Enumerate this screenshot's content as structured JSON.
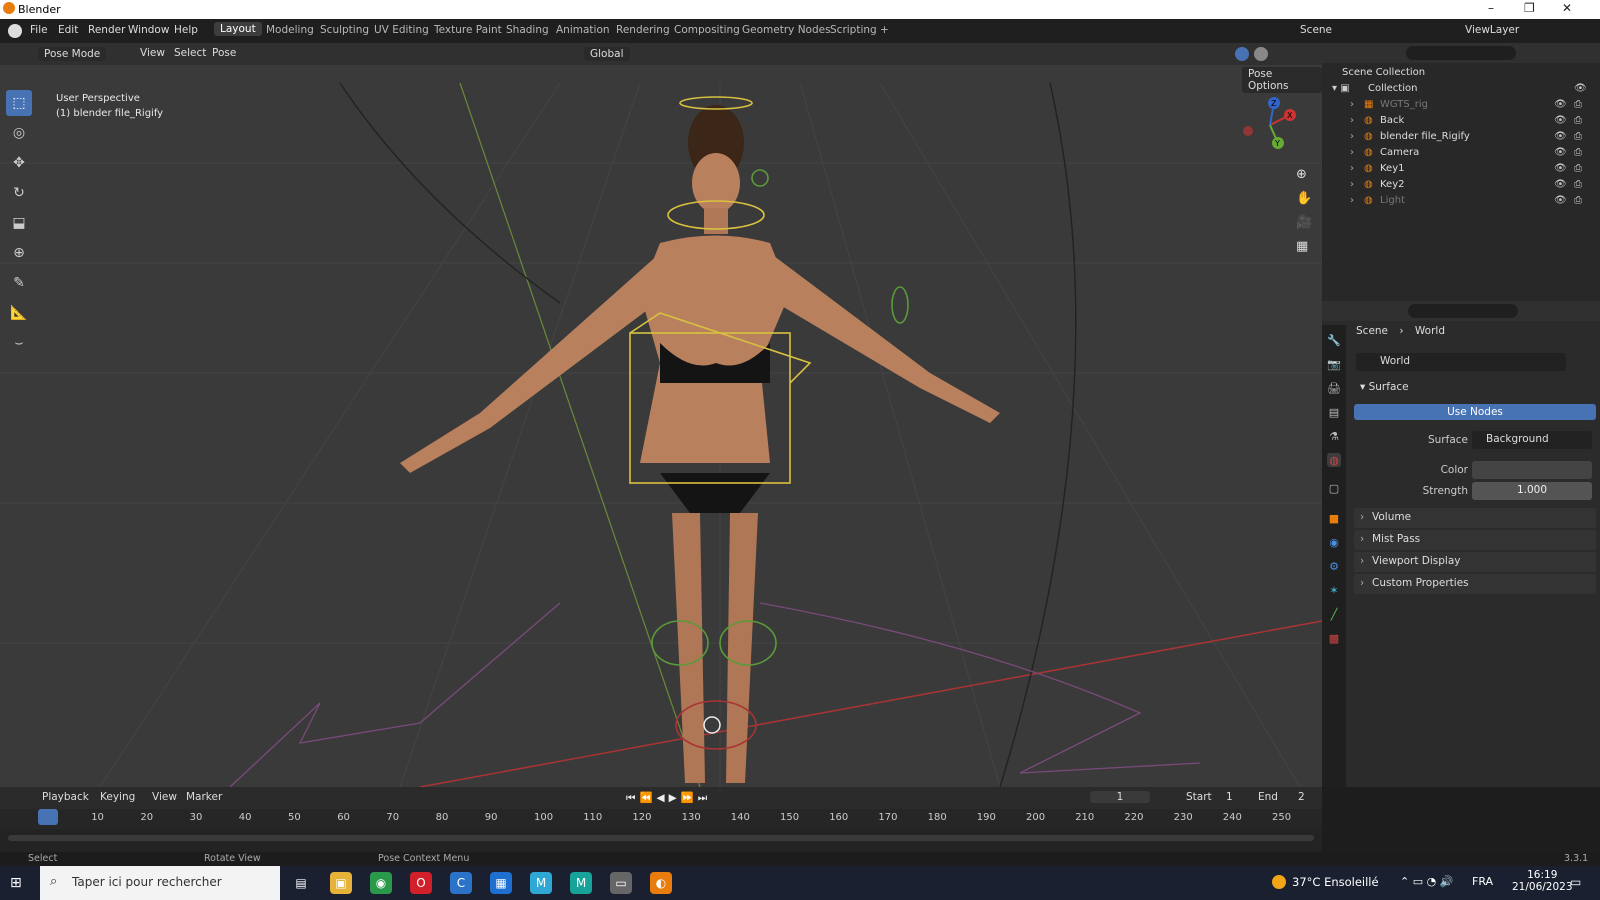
{
  "window": {
    "title": "Blender",
    "controls": [
      "–",
      "❐",
      "✕"
    ]
  },
  "menu": [
    "File",
    "Edit",
    "Render",
    "Window",
    "Help"
  ],
  "workspaces": [
    "Layout",
    "Modeling",
    "Sculpting",
    "UV Editing",
    "Texture Paint",
    "Shading",
    "Animation",
    "Rendering",
    "Compositing",
    "Geometry Nodes",
    "Scripting",
    "+"
  ],
  "scene": {
    "label": "Scene",
    "viewlayer": "ViewLayer"
  },
  "viewport": {
    "mode": "Pose Mode",
    "menus": [
      "View",
      "Select",
      "Pose"
    ],
    "orientation": "Global",
    "pose_options": "Pose Options",
    "info_line1": "User Perspective",
    "info_line2": "(1) blender file_Rigify",
    "gizmo": {
      "x": "X",
      "y": "Y",
      "z": "Z"
    }
  },
  "outliner": {
    "root": "Scene Collection",
    "collection": "Collection",
    "items": [
      {
        "name": "WGTS_rig",
        "dim": true
      },
      {
        "name": "Back",
        "dim": false
      },
      {
        "name": "blender file_Rigify",
        "dim": false
      },
      {
        "name": "Camera",
        "dim": false
      },
      {
        "name": "Key1",
        "dim": false
      },
      {
        "name": "Key2",
        "dim": false
      },
      {
        "name": "Light",
        "dim": true
      }
    ]
  },
  "properties": {
    "breadcrumb_scene": "Scene",
    "breadcrumb_world": "World",
    "world_name": "World",
    "surface_header": "Surface",
    "use_nodes": "Use Nodes",
    "surface_label": "Surface",
    "surface_value": "Background",
    "color_label": "Color",
    "strength_label": "Strength",
    "strength_value": "1.000",
    "sections": [
      "Volume",
      "Mist Pass",
      "Viewport Display",
      "Custom Properties"
    ]
  },
  "timeline": {
    "menus": [
      "Playback",
      "Keying",
      "View",
      "Marker"
    ],
    "current_frame": "1",
    "start_label": "Start",
    "start": "1",
    "end_label": "End",
    "end": "2",
    "ticks": [
      "1",
      "10",
      "20",
      "30",
      "40",
      "50",
      "60",
      "70",
      "80",
      "90",
      "100",
      "110",
      "120",
      "130",
      "140",
      "150",
      "160",
      "170",
      "180",
      "190",
      "200",
      "210",
      "220",
      "230",
      "240",
      "250"
    ]
  },
  "statusbar": {
    "select": "Select",
    "rotate": "Rotate View",
    "context": "Pose Context Menu",
    "version": "3.3.1"
  },
  "taskbar": {
    "search_placeholder": "Taper ici pour rechercher",
    "weather": "37°C Ensoleillé",
    "lang": "FRA",
    "time": "16:19",
    "date": "21/06/2023"
  },
  "colors": {
    "accent": "#4772b3",
    "orange": "#e87d0d"
  }
}
